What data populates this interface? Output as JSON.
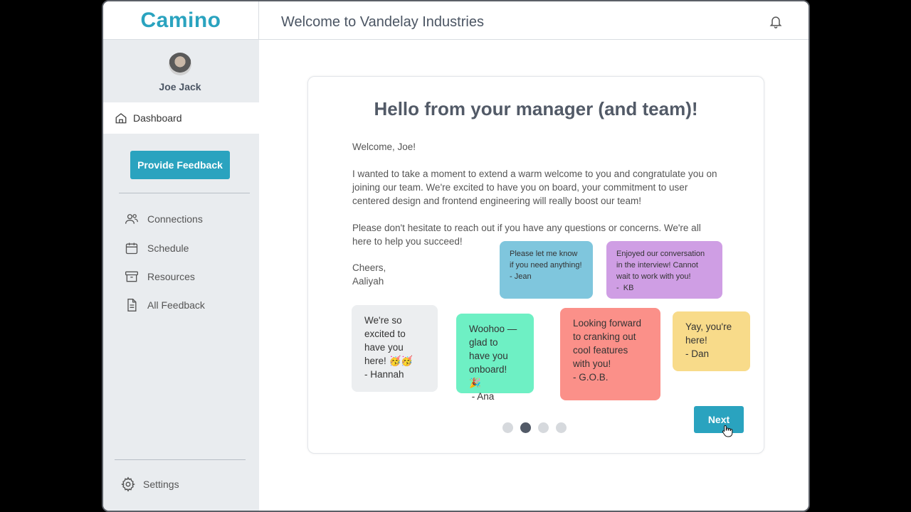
{
  "app": {
    "logo": "Camino",
    "header_title": "Welcome to Vandelay Industries"
  },
  "user": {
    "name": "Joe Jack"
  },
  "sidebar": {
    "dashboard_label": "Dashboard",
    "feedback_button": "Provide Feedback",
    "items": [
      {
        "label": "Connections",
        "icon": "people-icon"
      },
      {
        "label": "Schedule",
        "icon": "calendar-icon"
      },
      {
        "label": "Resources",
        "icon": "archive-box-icon"
      },
      {
        "label": "All Feedback",
        "icon": "document-icon"
      }
    ],
    "settings_label": "Settings"
  },
  "card": {
    "title": "Hello from your manager (and team)!",
    "greeting": "Welcome, Joe!",
    "paragraph1": "I wanted to take a moment to extend a warm welcome to you and congratulate you on joining our team. We're excited to have you on board, your commitment to user centered design and frontend engineering will really boost our team!",
    "paragraph2": "Please don't hesitate to reach out if you have any questions or concerns. We're all here to help you succeed!",
    "signoff_1": "Cheers,",
    "signoff_2": "Aaliyah",
    "notes": [
      {
        "text": "Please let me know if you need anything!\n- Jean",
        "color": "#7fc6dd"
      },
      {
        "text": "Enjoyed our conversation in the interview! Cannot wait to work with you!\n-  KB",
        "color": "#cf9ee4"
      },
      {
        "text": "We're so excited to have you here! 🥳🥳\n- Hannah",
        "color": "#eceef0"
      },
      {
        "text": "Woohoo — glad to have you onboard! 🎉\n - Ana",
        "color": "#6ef0c4"
      },
      {
        "text": "Looking forward to cranking out cool features with you!\n- G.O.B.",
        "color": "#fb9089"
      },
      {
        "text": "Yay, you're here!\n- Dan",
        "color": "#f8db8a"
      }
    ],
    "pagination": {
      "current": 2,
      "total": 4
    },
    "next_button": "Next"
  },
  "colors": {
    "accent": "#2aa3bf",
    "sidebar_bg": "#e9ecef"
  }
}
